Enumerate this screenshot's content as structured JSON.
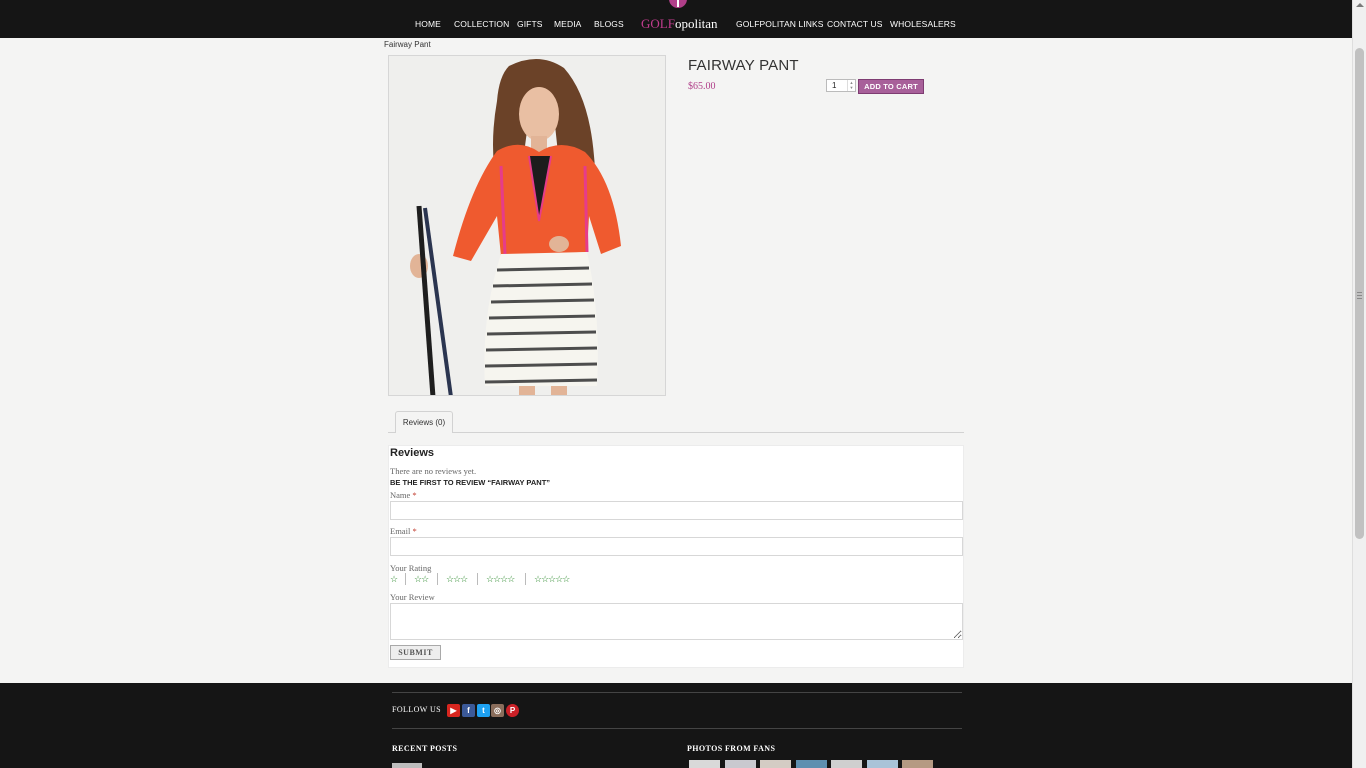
{
  "header": {
    "nav_left": [
      "HOME",
      "COLLECTION",
      "GIFTS",
      "MEDIA",
      "BLOGS"
    ],
    "brand_golf": "GOLF",
    "brand_rest": "opolitan",
    "nav_right": [
      "GOLFPOLITAN LINKS",
      "CONTACT US",
      "WHOLESALERS"
    ]
  },
  "breadcrumb": "Fairway Pant",
  "product": {
    "title": "FAIRWAY PANT",
    "price": "$65.00",
    "quantity": "1",
    "add_to_cart_label": "ADD TO CART"
  },
  "tabs": [
    "Reviews (0)"
  ],
  "reviews": {
    "heading": "Reviews",
    "empty_text": "There are no reviews yet.",
    "be_first": "BE THE FIRST TO REVIEW “FAIRWAY PANT”",
    "name_label": "Name",
    "email_label": "Email",
    "rating_label": "Your Rating",
    "review_label": "Your Review",
    "required_mark": "*",
    "rating_options": [
      "☆",
      "☆☆",
      "☆☆☆",
      "☆☆☆☆",
      "☆☆☆☆☆"
    ],
    "submit_label": "SUBMIT"
  },
  "footer": {
    "follow_label": "FOLLOW US",
    "social_icons": [
      "youtube-icon",
      "facebook-icon",
      "twitter-icon",
      "instagram-icon",
      "pinterest-icon"
    ],
    "recent_posts_heading": "RECENT POSTS",
    "photos_heading": "PHOTOS FROM FANS"
  },
  "colors": {
    "header_bg": "#151515",
    "brand_accent": "#c23c8e",
    "price": "#b03f89",
    "cart_button": "#a8609a",
    "rating_stars": "#2e8b2e"
  }
}
